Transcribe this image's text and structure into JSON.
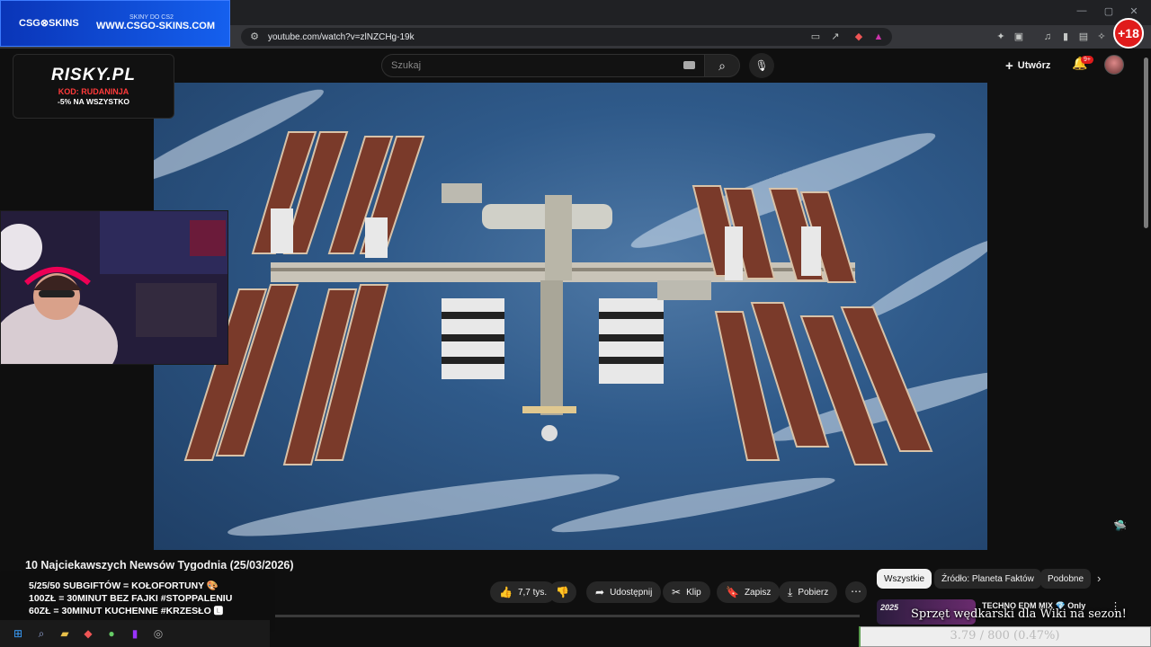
{
  "browser": {
    "url": "youtube.com/watch?v=zlNZCHg-19k",
    "window_controls": [
      "—",
      "▢",
      "✕"
    ]
  },
  "csgo_banner": {
    "logo": "CSG⊗SKINS",
    "tagline": "SKINY DO CS2",
    "site": "WWW.CSGO-SKINS.COM"
  },
  "adult_badge": "+18",
  "header": {
    "search_placeholder": "Szukaj",
    "create_label": "Utwórz",
    "notifications_badge": "9+"
  },
  "risky_overlay": {
    "brand": "RISKY.PL",
    "code": "KOD: RUDANINJA",
    "promo": "-5% NA WSZYSTKO"
  },
  "video": {
    "title": "10 Najciekawszych Newsów Tygodnia (25/03/2026)"
  },
  "actions": {
    "likes": "7,7 tys.",
    "share": "Udostępnij",
    "clip": "Klip",
    "save": "Zapisz",
    "download": "Pobierz"
  },
  "chips": [
    "Wszystkie",
    "Źródło: Planeta Faktów",
    "Podobne"
  ],
  "recommendation": {
    "thumb_label": "2025",
    "title": "TECHNO EDM MIX 💎 Only",
    "overlay_text": "Sprzęt wędkarski dla Wiki na sezon!"
  },
  "subgoal": {
    "text": "3.79 / 800 (0.47%)",
    "fraction": 0.0047
  },
  "stream_info": {
    "line1": "5/25/50 SUBGIFTÓW = KOŁOFORTUNY 🎨",
    "line2": "100ZŁ = 30MINUT BEZ FAJKI #STOPPALENIU",
    "line3": "60ZŁ = 30MINUT KUCHENNE #KRZESŁO 🅻"
  },
  "colors": {
    "youtube_bg": "#0f0f0f",
    "accent_red": "#e01b1b",
    "subgoal_fill": "#5a9c4e"
  }
}
